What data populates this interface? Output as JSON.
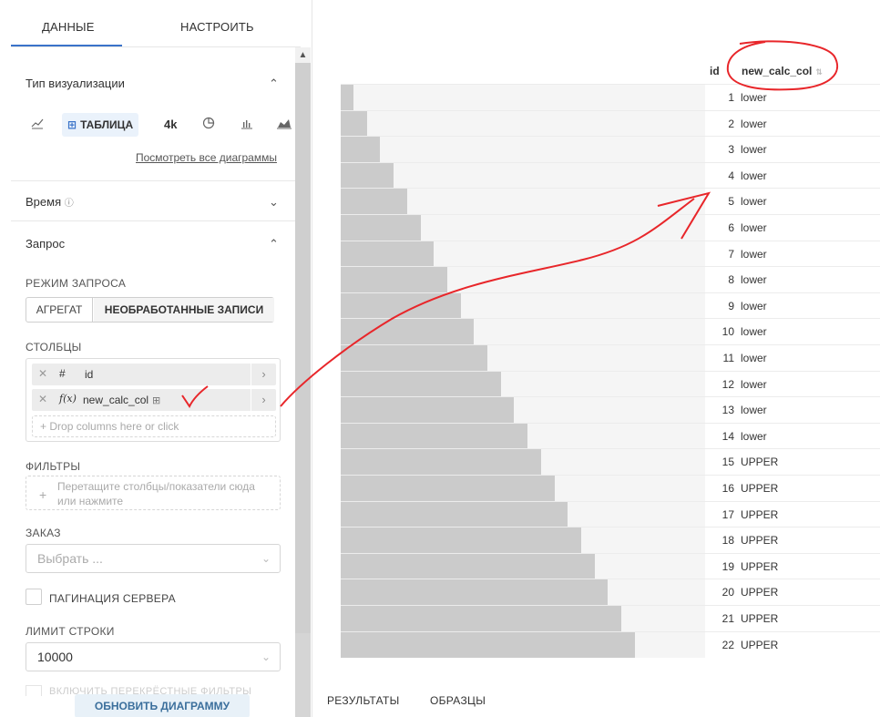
{
  "tabs": {
    "data": "ДАННЫЕ",
    "customize": "НАСТРОИТЬ"
  },
  "visualization": {
    "title": "Тип визуализации",
    "table_label": "ТАБЛИЦА",
    "big_number_label": "4k",
    "see_all": "Посмотреть все диаграммы"
  },
  "time": {
    "title": "Время"
  },
  "query": {
    "title": "Запрос",
    "mode_label": "РЕЖИМ ЗАПРОСА",
    "mode_options": [
      "АГРЕГАТ",
      "НЕОБРАБОТАННЫЕ ЗАПИСИ"
    ],
    "mode_selected": "НЕОБРАБОТАННЫЕ ЗАПИСИ",
    "columns_label": "СТОЛБЦЫ",
    "columns": [
      {
        "type_icon": "#",
        "name": "id"
      },
      {
        "type_icon": "f(x)",
        "name": "new_calc_col"
      }
    ],
    "columns_drop_placeholder": "Drop columns here or click",
    "filters_label": "ФИЛЬТРЫ",
    "filters_placeholder": "Перетащите столбцы/показатели сюда или нажмите",
    "order_label": "ЗАКАЗ",
    "order_placeholder": "Выбрать ...",
    "server_pagination_label": "ПАГИНАЦИЯ СЕРВЕРА",
    "row_limit_label": "ЛИМИТ СТРОКИ",
    "row_limit_value": "10000",
    "faded_option": "ВКЛЮЧИТЬ ПЕРЕКРЁСТНЫЕ ФИЛЬТРЫ",
    "update_button": "ОБНОВИТЬ ДИАГРАММУ"
  },
  "table": {
    "headers": [
      "id",
      "new_calc_col"
    ],
    "rows": [
      {
        "id": "1",
        "val": "lower"
      },
      {
        "id": "2",
        "val": "lower"
      },
      {
        "id": "3",
        "val": "lower"
      },
      {
        "id": "4",
        "val": "lower"
      },
      {
        "id": "5",
        "val": "lower"
      },
      {
        "id": "6",
        "val": "lower"
      },
      {
        "id": "7",
        "val": "lower"
      },
      {
        "id": "8",
        "val": "lower"
      },
      {
        "id": "9",
        "val": "lower"
      },
      {
        "id": "10",
        "val": "lower"
      },
      {
        "id": "11",
        "val": "lower"
      },
      {
        "id": "12",
        "val": "lower"
      },
      {
        "id": "13",
        "val": "lower"
      },
      {
        "id": "14",
        "val": "lower"
      },
      {
        "id": "15",
        "val": "UPPER"
      },
      {
        "id": "16",
        "val": "UPPER"
      },
      {
        "id": "17",
        "val": "UPPER"
      },
      {
        "id": "18",
        "val": "UPPER"
      },
      {
        "id": "19",
        "val": "UPPER"
      },
      {
        "id": "20",
        "val": "UPPER"
      },
      {
        "id": "21",
        "val": "UPPER"
      },
      {
        "id": "22",
        "val": "UPPER"
      }
    ],
    "bar_max": 22
  },
  "bottom_tabs": [
    "РЕЗУЛЬТАТЫ",
    "ОБРАЗЦЫ"
  ],
  "colors": {
    "accent": "#3a73c9",
    "annotation": "#e8262a",
    "bar": "#cbcbcb",
    "bar_track": "#f5f5f5"
  }
}
